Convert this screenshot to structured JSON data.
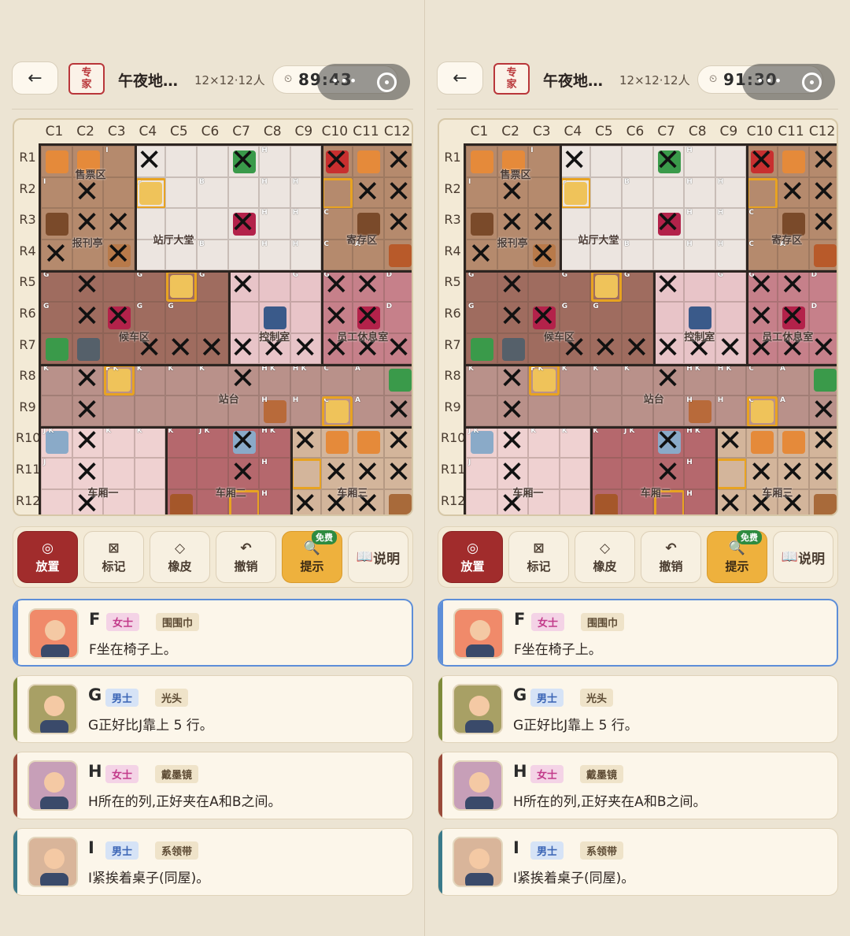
{
  "header": {
    "back_icon": "←",
    "difficulty_line1": "专",
    "difficulty_line2": "家",
    "title": "午夜地…",
    "size": "12×12·12人",
    "clock_icon": "⏲",
    "timer_left": "89:43",
    "timer_right": "91:30",
    "menu_dots": "•••"
  },
  "columns": [
    "C1",
    "C2",
    "C3",
    "C4",
    "C5",
    "C6",
    "C7",
    "C8",
    "C9",
    "C10",
    "C11",
    "C12"
  ],
  "rows": [
    "R1",
    "R2",
    "R3",
    "R4",
    "R5",
    "R6",
    "R7",
    "R8",
    "R9",
    "R10",
    "R11",
    "R12"
  ],
  "rooms": [
    "售票区",
    "站厅大堂",
    "寄存区",
    "报刊亭",
    "候车区",
    "控制室",
    "员工休息室",
    "站台",
    "车厢一",
    "车厢二",
    "车厢三"
  ],
  "x_mark": "✕",
  "toolbar": {
    "place": "放置",
    "place_icon": "◎",
    "mark": "标记",
    "mark_icon": "⊠",
    "erase": "橡皮",
    "erase_icon": "◇",
    "undo": "撤销",
    "undo_icon": "↶",
    "hint": "提示",
    "hint_icon": "🔍",
    "free": "免费",
    "help": "说明",
    "help_icon": "📖"
  },
  "clues": [
    {
      "letter": "F",
      "gender": "女士",
      "gender_type": "f",
      "trait": "围围巾",
      "text": "F坐在椅子上。",
      "stripe": "#5d8ed8",
      "avatar_bg": "#f08a6a"
    },
    {
      "letter": "G",
      "gender": "男士",
      "gender_type": "m",
      "trait": "光头",
      "text": "G正好比J靠上 5 行。",
      "stripe": "#7e8b3a",
      "avatar_bg": "#a8a065"
    },
    {
      "letter": "H",
      "gender": "女士",
      "gender_type": "f",
      "trait": "戴墨镜",
      "text": "H所在的列,正好夹在A和B之间。",
      "stripe": "#9a4a3a",
      "avatar_bg": "#c79fb8"
    },
    {
      "letter": "I",
      "gender": "男士",
      "gender_type": "m",
      "trait": "系领带",
      "text": "I紧挨着桌子(同屋)。",
      "stripe": "#3a7a8a",
      "avatar_bg": "#d9b59a"
    }
  ]
}
